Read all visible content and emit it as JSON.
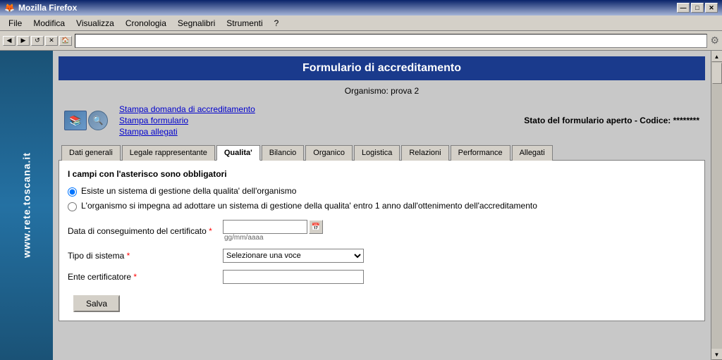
{
  "window": {
    "title": "Mozilla Firefox",
    "icon": "🦊"
  },
  "window_controls": {
    "minimize": "—",
    "maximize": "□",
    "close": "✕"
  },
  "menu": {
    "items": [
      "File",
      "Modifica",
      "Visualizza",
      "Cronologia",
      "Segnalibri",
      "Strumenti",
      "?"
    ]
  },
  "side_banner": {
    "text": "www.rete.toscana.it"
  },
  "form_header": {
    "title": "Formulario di accreditamento"
  },
  "organismo": {
    "label": "Organismo: prova 2"
  },
  "print_section": {
    "link1": "Stampa domanda di accreditamento",
    "link2": "Stampa formulario",
    "link3": "Stampa allegati",
    "status": "Stato del formulario aperto - Codice: ********"
  },
  "tabs": {
    "items": [
      {
        "label": "Dati generali",
        "active": false
      },
      {
        "label": "Legale rappresentante",
        "active": false
      },
      {
        "label": "Qualita'",
        "active": true
      },
      {
        "label": "Bilancio",
        "active": false
      },
      {
        "label": "Organico",
        "active": false
      },
      {
        "label": "Logistica",
        "active": false
      },
      {
        "label": "Relazioni",
        "active": false
      },
      {
        "label": "Performance",
        "active": false
      },
      {
        "label": "Allegati",
        "active": false
      }
    ]
  },
  "form": {
    "mandatory_notice": "I campi con l'asterisco sono obbligatori",
    "radio1": "Esiste un sistema di gestione della qualita' dell'organismo",
    "radio2": "L'organismo si impegna ad adottare un sistema di gestione della qualita' entro 1 anno dall'ottenimento dell'accreditamento",
    "date_label": "Data di conseguimento del certificato",
    "date_required": "*",
    "date_hint": "gg/mm/aaaa",
    "tipo_label": "Tipo di sistema",
    "tipo_required": "*",
    "tipo_placeholder": "Selezionare una voce",
    "ente_label": "Ente certificatore",
    "ente_required": "*",
    "save_button": "Salva"
  }
}
